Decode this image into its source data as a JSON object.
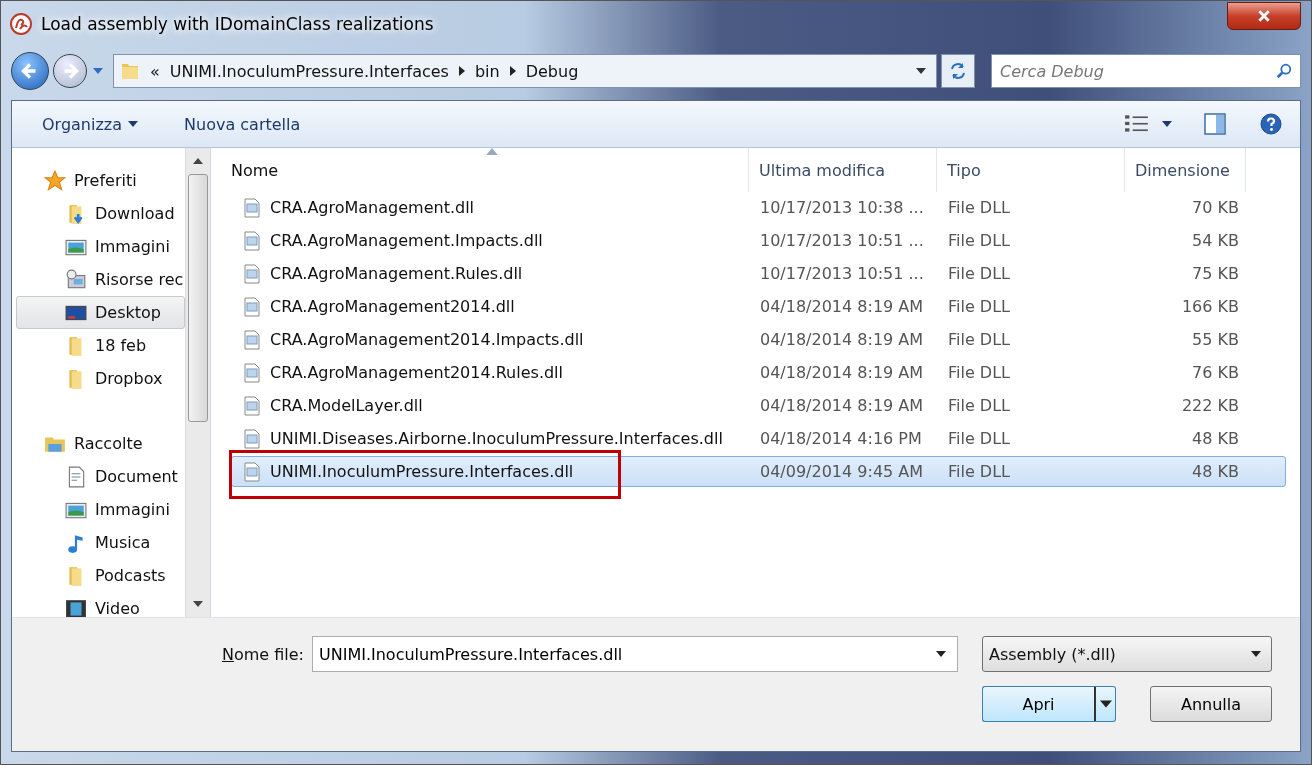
{
  "window": {
    "title": "Load assembly with IDomainClass realizations"
  },
  "address": {
    "crumbs": [
      "«",
      "UNIMI.InoculumPressure.Interfaces",
      "bin",
      "Debug"
    ]
  },
  "search": {
    "placeholder": "Cerca Debug"
  },
  "toolbar": {
    "items": [
      "Organizza",
      "Nuova cartella"
    ]
  },
  "sidebar": {
    "groups": [
      {
        "label": "Preferiti",
        "kind": "star",
        "children": [
          {
            "label": "Download",
            "kind": "download",
            "selected": false
          },
          {
            "label": "Immagini",
            "kind": "pictures",
            "selected": false
          },
          {
            "label": "Risorse rec",
            "kind": "recent",
            "selected": false
          },
          {
            "label": "Desktop",
            "kind": "desktop",
            "selected": true
          },
          {
            "label": "18 feb",
            "kind": "folder",
            "selected": false
          },
          {
            "label": "Dropbox",
            "kind": "folder",
            "selected": false
          }
        ]
      },
      {
        "label": "Raccolte",
        "kind": "library",
        "children": [
          {
            "label": "Document",
            "kind": "document",
            "selected": false
          },
          {
            "label": "Immagini",
            "kind": "pictures",
            "selected": false
          },
          {
            "label": "Musica",
            "kind": "music",
            "selected": false
          },
          {
            "label": "Podcasts",
            "kind": "folder",
            "selected": false
          },
          {
            "label": "Video",
            "kind": "video",
            "selected": false
          }
        ]
      }
    ]
  },
  "table": {
    "columns": [
      "Nome",
      "Ultima modifica",
      "Tipo",
      "Dimensione"
    ],
    "rows": [
      {
        "name": "CRA.AgroManagement.dll",
        "modified": "10/17/2013 10:38 ...",
        "type": "File DLL",
        "size": "70 KB",
        "selected": false,
        "outlined": false
      },
      {
        "name": "CRA.AgroManagement.Impacts.dll",
        "modified": "10/17/2013 10:51 ...",
        "type": "File DLL",
        "size": "54 KB",
        "selected": false,
        "outlined": false
      },
      {
        "name": "CRA.AgroManagement.Rules.dll",
        "modified": "10/17/2013 10:51 ...",
        "type": "File DLL",
        "size": "75 KB",
        "selected": false,
        "outlined": false
      },
      {
        "name": "CRA.AgroManagement2014.dll",
        "modified": "04/18/2014 8:19 AM",
        "type": "File DLL",
        "size": "166 KB",
        "selected": false,
        "outlined": false
      },
      {
        "name": "CRA.AgroManagement2014.Impacts.dll",
        "modified": "04/18/2014 8:19 AM",
        "type": "File DLL",
        "size": "55 KB",
        "selected": false,
        "outlined": false
      },
      {
        "name": "CRA.AgroManagement2014.Rules.dll",
        "modified": "04/18/2014 8:19 AM",
        "type": "File DLL",
        "size": "76 KB",
        "selected": false,
        "outlined": false
      },
      {
        "name": "CRA.ModelLayer.dll",
        "modified": "04/18/2014 8:19 AM",
        "type": "File DLL",
        "size": "222 KB",
        "selected": false,
        "outlined": false
      },
      {
        "name": "UNIMI.Diseases.Airborne.InoculumPressure.Interfaces.dll",
        "modified": "04/18/2014 4:16 PM",
        "type": "File DLL",
        "size": "48 KB",
        "selected": false,
        "outlined": false
      },
      {
        "name": "UNIMI.InoculumPressure.Interfaces.dll",
        "modified": "04/09/2014 9:45 AM",
        "type": "File DLL",
        "size": "48 KB",
        "selected": true,
        "outlined": true
      }
    ]
  },
  "filename": {
    "label": "Nome file:",
    "value": "UNIMI.InoculumPressure.Interfaces.dll"
  },
  "filter": {
    "value": "Assembly (*.dll)"
  },
  "buttons": [
    "Apri",
    "Annulla"
  ]
}
